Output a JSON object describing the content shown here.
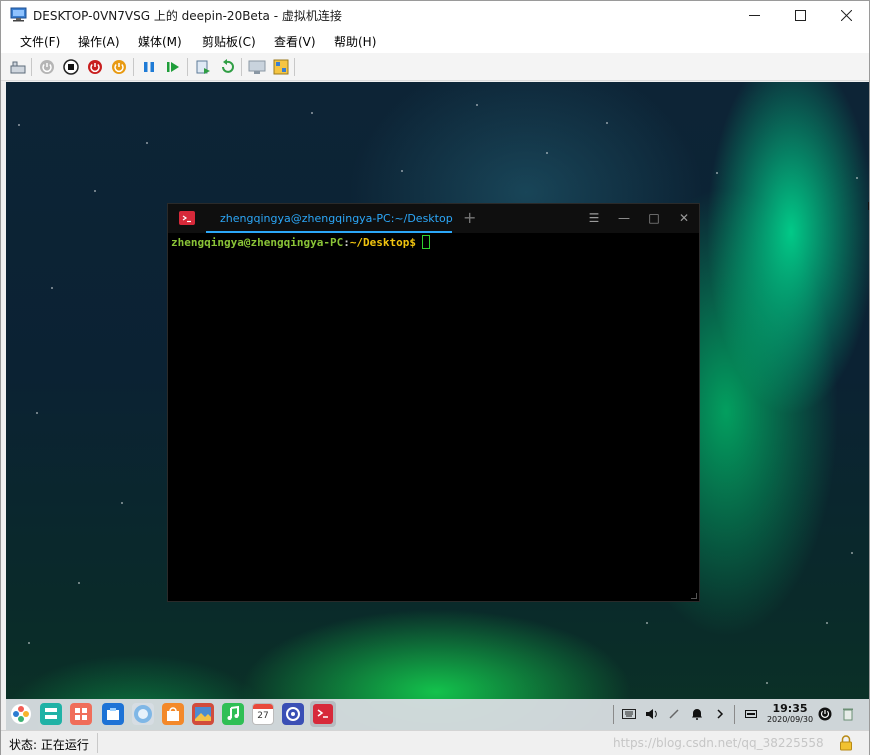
{
  "window": {
    "title": "DESKTOP-0VN7VSG 上的 deepin-20Beta - 虚拟机连接",
    "controls": {
      "minimize": "—",
      "maximize": "☐",
      "close": "✕"
    }
  },
  "menu": {
    "items": [
      "文件(F)",
      "操作(A)",
      "媒体(M)",
      "剪贴板(C)",
      "查看(V)",
      "帮助(H)"
    ]
  },
  "toolbar": {
    "buttons": [
      "ctrl-alt-del-icon",
      "start-icon",
      "turn-off-icon",
      "shut-down-icon",
      "save-icon",
      "pause-icon",
      "resume-icon",
      "checkpoint-icon",
      "revert-icon",
      "enhanced-session-icon",
      "share-icon"
    ]
  },
  "terminal": {
    "tab_title": "zhengqingya@zhengqingya-PC:~/Desktop",
    "prompt_user": "zhengqingya@zhengqingya-PC",
    "prompt_colon": ":",
    "prompt_path": "~/Desktop",
    "prompt_dollar": "$",
    "new_tab": "+",
    "menu_glyph": "☰",
    "min_glyph": "—",
    "max_glyph": "□",
    "close_glyph": "✕"
  },
  "dock": {
    "apps": [
      "launcher-icon",
      "multitasking-icon",
      "app-store-icon",
      "file-manager-icon",
      "browser-icon",
      "app-store-bag-icon",
      "image-viewer-icon",
      "music-icon",
      "calendar-icon",
      "settings-icon",
      "terminal-icon"
    ],
    "calendar_day": "27",
    "clock_time": "19:35",
    "clock_date": "2020/09/30"
  },
  "status": {
    "text": "状态: 正在运行",
    "watermark": "https://blog.csdn.net/qq_38225558"
  },
  "colors": {
    "terminal_tab_accent": "#2ca7f8",
    "prompt_user": "#8ac437",
    "prompt_path": "#f1c40f",
    "cursor": "#2fd12f"
  }
}
